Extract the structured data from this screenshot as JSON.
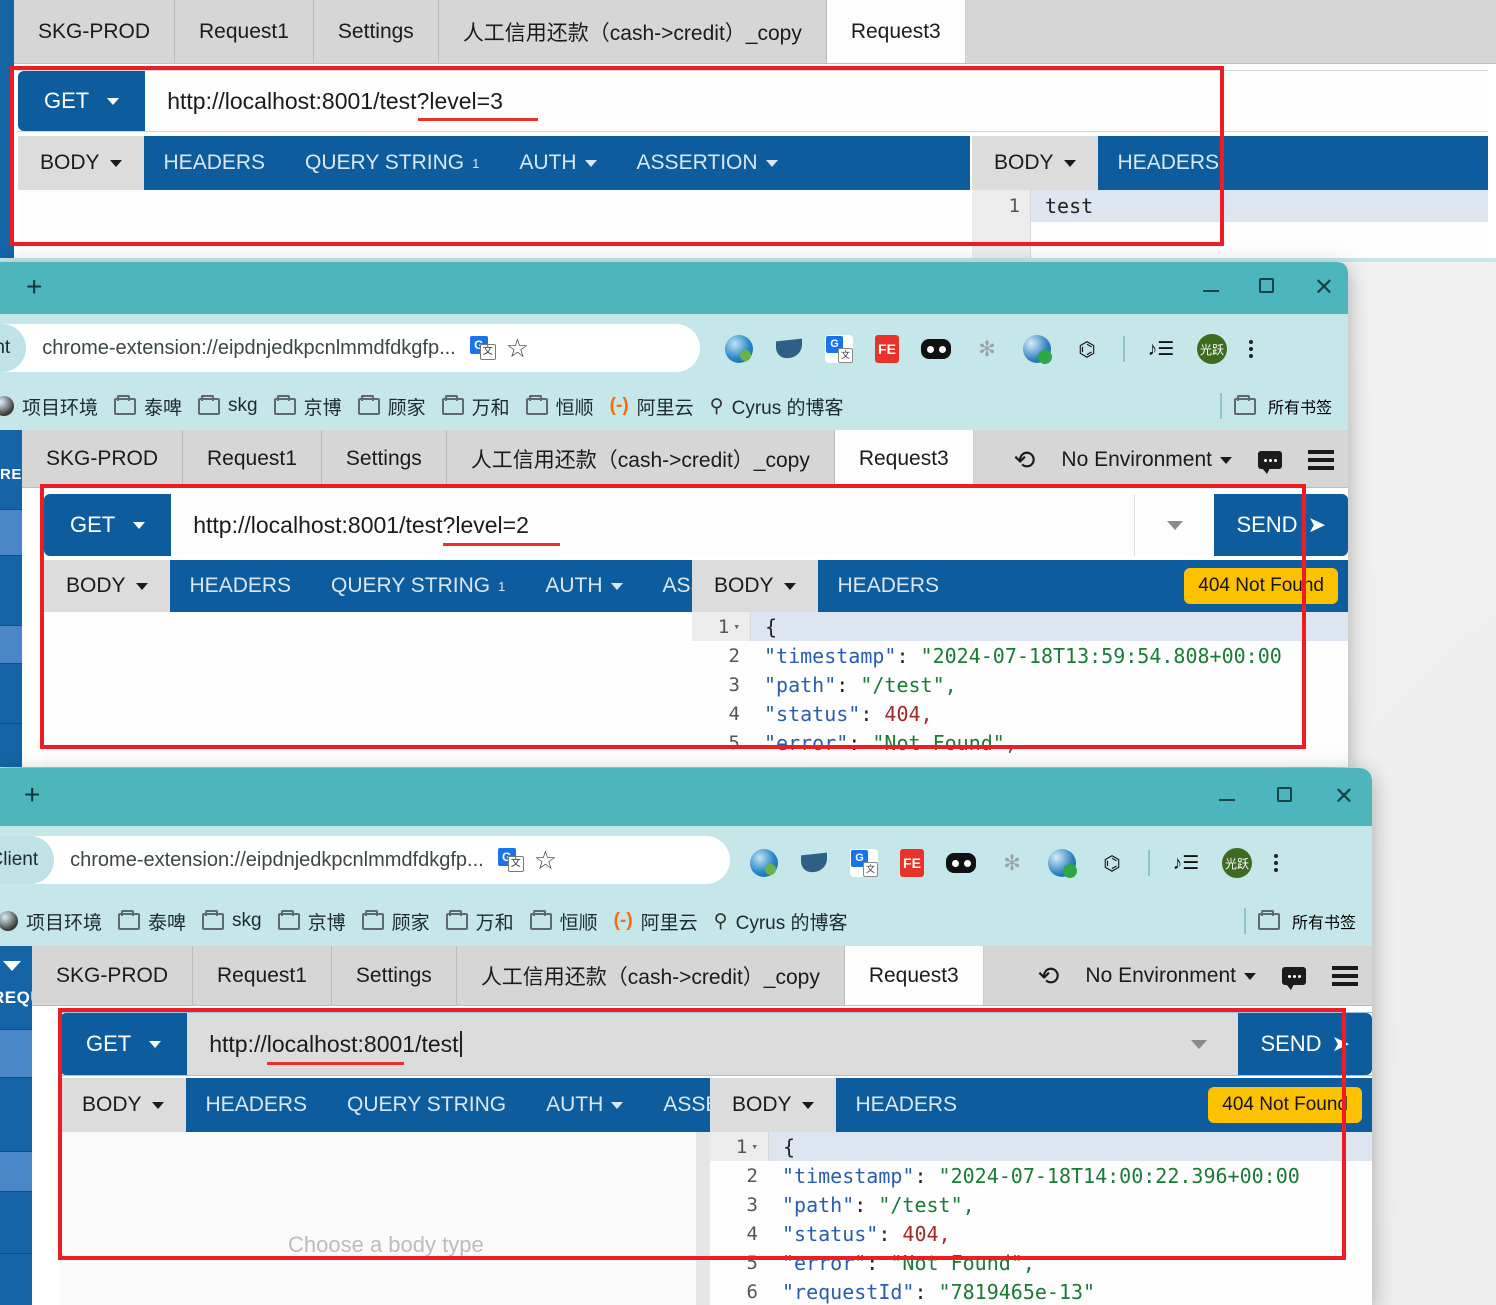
{
  "app": {
    "name": "Restlet / REST Client",
    "accent_blue": "#0d5c9e",
    "titlebar_teal": "#4db6bd",
    "omnibar_teal": "#c6e7ea",
    "annotation_red": "#ee1c23",
    "status_badge_yellow": "#fcc200"
  },
  "rest_tabs": [
    {
      "label": "SKG-PROD",
      "active": false
    },
    {
      "label": "Request1",
      "active": false
    },
    {
      "label": "Settings",
      "active": false
    },
    {
      "label": "人工信用还款（cash->credit）_copy",
      "active": false
    },
    {
      "label": "Request3",
      "active": true
    }
  ],
  "request_segments": [
    {
      "label": "BODY",
      "dropdown": true,
      "active": true
    },
    {
      "label": "HEADERS",
      "dropdown": false,
      "active": false
    },
    {
      "label": "QUERY STRING",
      "dropdown": false,
      "active": false,
      "superscript": "1"
    },
    {
      "label": "AUTH",
      "dropdown": true,
      "active": false
    },
    {
      "label": "ASSERTION",
      "dropdown": true,
      "active": false
    }
  ],
  "request_segments_no_sup": [
    {
      "label": "BODY",
      "dropdown": true,
      "active": true
    },
    {
      "label": "HEADERS",
      "dropdown": false,
      "active": false
    },
    {
      "label": "QUERY STRING",
      "dropdown": false,
      "active": false,
      "superscript": ""
    },
    {
      "label": "AUTH",
      "dropdown": true,
      "active": false
    },
    {
      "label": "ASSERTION",
      "dropdown": true,
      "active": false
    }
  ],
  "response_segments": [
    {
      "label": "BODY",
      "dropdown": true,
      "active": true
    },
    {
      "label": "HEADERS",
      "dropdown": false,
      "active": false
    }
  ],
  "toolbar": {
    "method": "GET",
    "send_label": "SEND",
    "send_icon": "send-arrow-icon",
    "environment": "No Environment",
    "refresh_icon": "refresh-icon",
    "comment_icon": "comment-icon",
    "menu_icon": "hamburger-menu-icon"
  },
  "windows": [
    {
      "id": "window-top",
      "url": "http://localhost:8001/test?level=3",
      "url_underline_text": "level=3",
      "response_body_lines": [
        {
          "no": "1",
          "text": "test",
          "highlight": true
        }
      ],
      "status": ""
    },
    {
      "id": "window-middle",
      "browser": {
        "newtab_icon": "new-tab-plus-icon",
        "minimize_icon": "minimize-icon",
        "maximize_icon": "maximize-icon",
        "close_icon": "close-icon",
        "tab_title": "REST Client",
        "address": "chrome-extension://eipdnjedkpcnlmmdfdkgfp...",
        "translate_icon": "google-translate-icon",
        "bookmark_star_icon": "bookmark-star-icon",
        "extensions": [
          "globe-extension-icon",
          "book-extension-icon",
          "google-translate-extension-icon",
          "fe-extension-icon",
          "dots-extension-icon",
          "command-extension-icon",
          "idm-extension-icon",
          "puzzle-extensions-icon"
        ],
        "media_icon": "media-control-icon",
        "profile_initials": "光跃",
        "menu_icon": "chrome-menu-icon",
        "bookmarks": [
          {
            "label": "项目环境",
            "icon": "site-globe-icon"
          },
          {
            "label": "泰啤",
            "icon": "folder-icon"
          },
          {
            "label": "skg",
            "icon": "folder-icon"
          },
          {
            "label": "京博",
            "icon": "folder-icon"
          },
          {
            "label": "顾家",
            "icon": "folder-icon"
          },
          {
            "label": "万和",
            "icon": "folder-icon"
          },
          {
            "label": "恒顺",
            "icon": "folder-icon"
          },
          {
            "label": "阿里云",
            "icon": "aliyun-icon"
          },
          {
            "label": "Cyrus 的博客",
            "icon": "blog-icon"
          }
        ],
        "all_bookmarks": "所有书签"
      },
      "url": "http://localhost:8001/test?level=2",
      "url_underline_text": "level=2",
      "status": "404 Not Found",
      "response_body_lines": [
        {
          "no": "1",
          "fold": true,
          "raw": "{"
        },
        {
          "no": "2",
          "key": "\"timestamp\"",
          "sep": ": ",
          "val": "\"2024-07-18T13:59:54.808+00:00",
          "type": "s"
        },
        {
          "no": "3",
          "key": "\"path\"",
          "sep": ": ",
          "val": "\"/test\",",
          "type": "s"
        },
        {
          "no": "4",
          "key": "\"status\"",
          "sep": ": ",
          "val": "404,",
          "type": "n"
        },
        {
          "no": "5",
          "key": "\"error\"",
          "sep": ": ",
          "val": "\"Not Found\",",
          "type": "s"
        }
      ]
    },
    {
      "id": "window-bottom",
      "browser": {
        "newtab_icon": "new-tab-plus-icon",
        "minimize_icon": "minimize-icon",
        "maximize_icon": "maximize-icon",
        "close_icon": "close-icon",
        "tab_title": "& REST Client",
        "address": "chrome-extension://eipdnjedkpcnlmmdfdkgfp...",
        "translate_icon": "google-translate-icon",
        "bookmark_star_icon": "bookmark-star-icon",
        "profile_initials": "光跃",
        "bookmarks": [
          {
            "label": "项目环境",
            "icon": "site-globe-icon"
          },
          {
            "label": "泰啤",
            "icon": "folder-icon"
          },
          {
            "label": "skg",
            "icon": "folder-icon"
          },
          {
            "label": "京博",
            "icon": "folder-icon"
          },
          {
            "label": "顾家",
            "icon": "folder-icon"
          },
          {
            "label": "万和",
            "icon": "folder-icon"
          },
          {
            "label": "恒顺",
            "icon": "folder-icon"
          },
          {
            "label": "阿里云",
            "icon": "aliyun-icon"
          },
          {
            "label": "Cyrus 的博客",
            "icon": "blog-icon"
          }
        ],
        "all_bookmarks": "所有书签"
      },
      "url": "http://localhost:8001/test",
      "url_underline_text": "8001/test",
      "status": "404 Not Found",
      "body_placeholder": "Choose a body type",
      "response_body_lines": [
        {
          "no": "1",
          "fold": true,
          "raw": "{"
        },
        {
          "no": "2",
          "key": "\"timestamp\"",
          "sep": ": ",
          "val": "\"2024-07-18T14:00:22.396+00:00",
          "type": "s"
        },
        {
          "no": "3",
          "key": "\"path\"",
          "sep": ": ",
          "val": "\"/test\",",
          "type": "s"
        },
        {
          "no": "4",
          "key": "\"status\"",
          "sep": ": ",
          "val": "404,",
          "type": "n"
        },
        {
          "no": "5",
          "key": "\"error\"",
          "sep": ": ",
          "val": "\"Not Found\",",
          "type": "s"
        },
        {
          "no": "6",
          "key": "\"requestId\"",
          "sep": ": ",
          "val": "\"7819465e-13\"",
          "type": "s"
        }
      ]
    }
  ],
  "sidebar": {
    "label_top": "REQUEST",
    "label_bottom": "REQUEST"
  }
}
